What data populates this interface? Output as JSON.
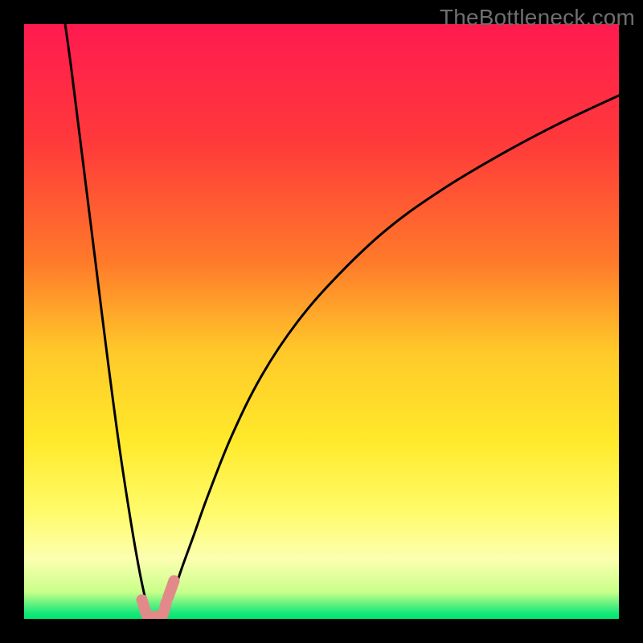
{
  "watermark": "TheBottleneck.com",
  "chart_data": {
    "type": "line",
    "title": "",
    "xlabel": "",
    "ylabel": "",
    "xlim": [
      0,
      100
    ],
    "ylim": [
      0,
      100
    ],
    "gradient_stops": [
      {
        "offset": 0.0,
        "color": "#ff1a4f"
      },
      {
        "offset": 0.2,
        "color": "#ff3a3a"
      },
      {
        "offset": 0.4,
        "color": "#ff7a2a"
      },
      {
        "offset": 0.55,
        "color": "#ffc92a"
      },
      {
        "offset": 0.7,
        "color": "#ffe92a"
      },
      {
        "offset": 0.82,
        "color": "#fffb6a"
      },
      {
        "offset": 0.9,
        "color": "#fcffb0"
      },
      {
        "offset": 0.955,
        "color": "#c8ff8a"
      },
      {
        "offset": 0.99,
        "color": "#17e87a"
      },
      {
        "offset": 1.0,
        "color": "#00e66a"
      }
    ],
    "series": [
      {
        "name": "left-branch",
        "x": [
          6.9,
          8.0,
          10.0,
          12.0,
          14.0,
          16.0,
          18.0,
          19.5,
          20.7,
          21.2
        ],
        "y": [
          100,
          92,
          76,
          60,
          44,
          29,
          16,
          7.5,
          2,
          0
        ]
      },
      {
        "name": "right-branch",
        "x": [
          23.5,
          24.2,
          25.0,
          26.5,
          28.5,
          31.0,
          35.0,
          40.0,
          46.0,
          53.0,
          61.0,
          70.0,
          80.0,
          90.0,
          100.0
        ],
        "y": [
          0,
          2,
          4,
          8.5,
          14,
          21,
          31,
          41,
          50,
          58,
          65.5,
          72,
          78,
          83.3,
          88
        ]
      }
    ],
    "markers": {
      "name": "highlight-caps",
      "color": "#e28a8a",
      "stroke_width": 14,
      "paths": [
        [
          [
            19.8,
            3.2
          ],
          [
            20.7,
            0.5
          ],
          [
            21.4,
            0.4
          ],
          [
            22.3,
            0.4
          ],
          [
            23.2,
            0.5
          ],
          [
            23.9,
            2.8
          ]
        ],
        [
          [
            24.2,
            3.6
          ],
          [
            25.2,
            6.4
          ]
        ]
      ]
    }
  }
}
